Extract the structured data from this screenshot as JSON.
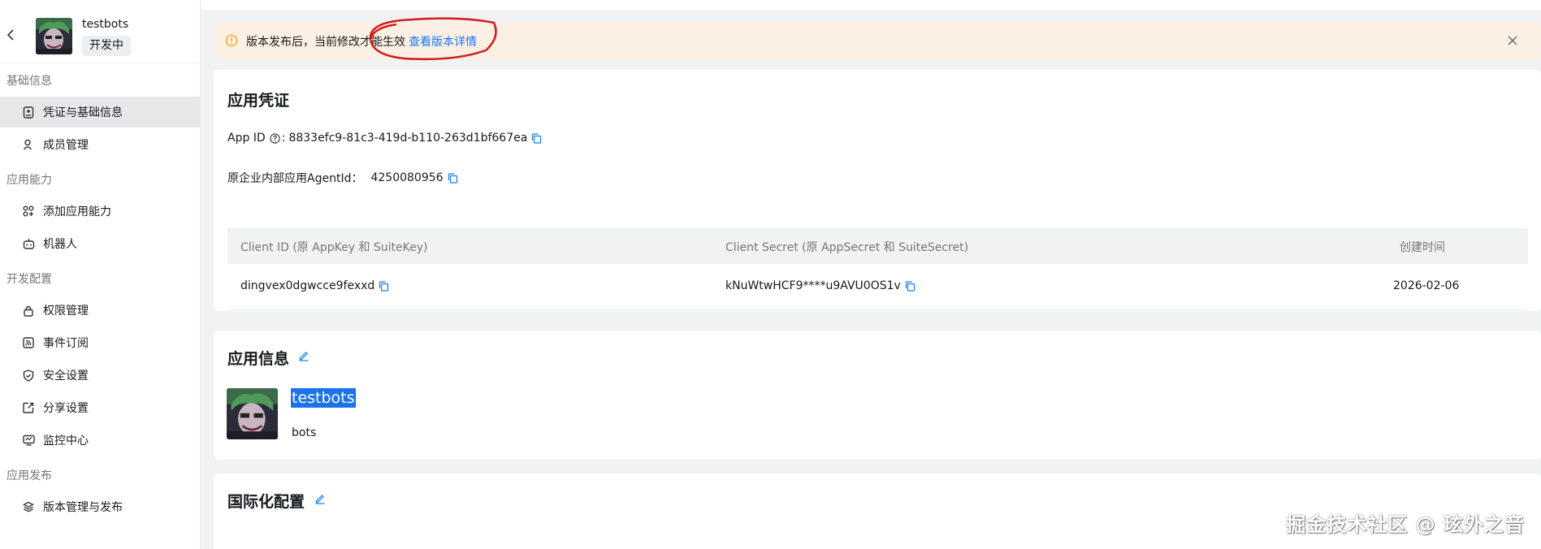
{
  "app": {
    "name": "testbots",
    "status": "开发中"
  },
  "sidebar": {
    "sections": [
      {
        "title": "基础信息",
        "items": [
          {
            "label": "凭证与基础信息",
            "icon": "credential-icon",
            "active": true
          },
          {
            "label": "成员管理",
            "icon": "user-icon"
          }
        ]
      },
      {
        "title": "应用能力",
        "items": [
          {
            "label": "添加应用能力",
            "icon": "apps-icon"
          },
          {
            "label": "机器人",
            "icon": "robot-icon"
          }
        ]
      },
      {
        "title": "开发配置",
        "items": [
          {
            "label": "权限管理",
            "icon": "lock-icon"
          },
          {
            "label": "事件订阅",
            "icon": "rss-icon"
          },
          {
            "label": "安全设置",
            "icon": "shield-icon"
          },
          {
            "label": "分享设置",
            "icon": "share-icon"
          },
          {
            "label": "监控中心",
            "icon": "monitor-icon"
          }
        ]
      },
      {
        "title": "应用发布",
        "items": [
          {
            "label": "版本管理与发布",
            "icon": "layers-icon"
          }
        ]
      }
    ]
  },
  "banner": {
    "message": "版本发布后，当前修改才能生效",
    "link": "查看版本详情"
  },
  "credentials": {
    "title": "应用凭证",
    "app_id_label": "App ID",
    "app_id_value": "8833efc9-81c3-419d-b110-263d1bf667ea",
    "agent_label": "原企业内部应用AgentId：",
    "agent_value": "4250080956",
    "table": {
      "headers": [
        "Client ID (原 AppKey 和 SuiteKey)",
        "Client Secret (原 AppSecret 和 SuiteSecret)",
        "创建时间"
      ],
      "rows": [
        [
          "dingvex0dgwcce9fexxd",
          "kNuWtwHCF9****u9AVU0OS1v",
          "2026-02-06"
        ]
      ]
    }
  },
  "app_info": {
    "title": "应用信息",
    "name": "testbots",
    "description": "bots"
  },
  "i18n": {
    "title": "国际化配置"
  },
  "watermark": "掘金技术社区 @ 玹外之音",
  "colors": {
    "accent": "#1677ff",
    "banner_bg": "#fbf0e3",
    "warn": "#f5a623",
    "highlight": "#1a73e8",
    "annotation": "#d21a1a"
  }
}
